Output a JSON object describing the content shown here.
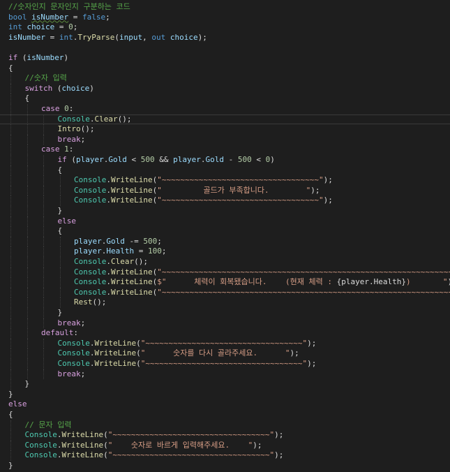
{
  "editor": {
    "background": "#1e1e1e",
    "colors": {
      "keyword": "#569cd6",
      "control": "#d8a0df",
      "variable": "#9cdcfe",
      "type": "#4ec9b0",
      "method": "#dcdcaa",
      "string": "#d69d85",
      "number": "#b5cea8",
      "comment": "#57a64a",
      "plain": "#dcdcdc"
    },
    "current_line": 11,
    "lines": [
      {
        "indent": 0,
        "tokens": [
          [
            "cmt",
            "//숫자인지 문자인지 구분하는 코드"
          ]
        ]
      },
      {
        "indent": 0,
        "tokens": [
          [
            "kw",
            "bool"
          ],
          [
            "pl",
            " "
          ],
          [
            "var",
            "isNumber",
            "squiggle"
          ],
          [
            "pl",
            " = "
          ],
          [
            "kw",
            "false"
          ],
          [
            "pl",
            ";"
          ]
        ]
      },
      {
        "indent": 0,
        "tokens": [
          [
            "kw",
            "int"
          ],
          [
            "pl",
            " "
          ],
          [
            "var",
            "choice"
          ],
          [
            "pl",
            " = "
          ],
          [
            "num",
            "0"
          ],
          [
            "pl",
            ";"
          ]
        ]
      },
      {
        "indent": 0,
        "tokens": [
          [
            "var",
            "isNumber"
          ],
          [
            "pl",
            " = "
          ],
          [
            "kw",
            "int"
          ],
          [
            "pl",
            "."
          ],
          [
            "fn",
            "TryParse"
          ],
          [
            "pl",
            "("
          ],
          [
            "var",
            "input"
          ],
          [
            "pl",
            ", "
          ],
          [
            "kw",
            "out"
          ],
          [
            "pl",
            " "
          ],
          [
            "var",
            "choice"
          ],
          [
            "pl",
            ");"
          ]
        ]
      },
      {
        "indent": 0,
        "tokens": []
      },
      {
        "indent": 0,
        "tokens": [
          [
            "ctl",
            "if"
          ],
          [
            "pl",
            " ("
          ],
          [
            "var",
            "isNumber"
          ],
          [
            "pl",
            ")"
          ]
        ]
      },
      {
        "indent": 0,
        "tokens": [
          [
            "pl",
            "{"
          ]
        ]
      },
      {
        "indent": 1,
        "tokens": [
          [
            "cmt",
            "//숫자 입력"
          ]
        ]
      },
      {
        "indent": 1,
        "tokens": [
          [
            "ctl",
            "switch"
          ],
          [
            "pl",
            " ("
          ],
          [
            "var",
            "choice"
          ],
          [
            "pl",
            ")"
          ]
        ]
      },
      {
        "indent": 1,
        "tokens": [
          [
            "pl",
            "{"
          ]
        ]
      },
      {
        "indent": 2,
        "tokens": [
          [
            "ctl",
            "case"
          ],
          [
            "pl",
            " "
          ],
          [
            "num",
            "0"
          ],
          [
            "pl",
            ":"
          ]
        ]
      },
      {
        "indent": 3,
        "tokens": [
          [
            "type",
            "Console"
          ],
          [
            "pl",
            "."
          ],
          [
            "fn",
            "Clear"
          ],
          [
            "pl",
            "();"
          ]
        ]
      },
      {
        "indent": 3,
        "tokens": [
          [
            "fn",
            "Intro"
          ],
          [
            "pl",
            "();"
          ]
        ]
      },
      {
        "indent": 3,
        "tokens": [
          [
            "ctl",
            "break"
          ],
          [
            "pl",
            ";"
          ]
        ]
      },
      {
        "indent": 2,
        "tokens": [
          [
            "ctl",
            "case"
          ],
          [
            "pl",
            " "
          ],
          [
            "num",
            "1"
          ],
          [
            "pl",
            ":"
          ]
        ]
      },
      {
        "indent": 3,
        "tokens": [
          [
            "ctl",
            "if"
          ],
          [
            "pl",
            " ("
          ],
          [
            "var",
            "player"
          ],
          [
            "pl",
            "."
          ],
          [
            "var",
            "Gold"
          ],
          [
            "pl",
            " < "
          ],
          [
            "num",
            "500"
          ],
          [
            "pl",
            " && "
          ],
          [
            "var",
            "player"
          ],
          [
            "pl",
            "."
          ],
          [
            "var",
            "Gold"
          ],
          [
            "pl",
            " - "
          ],
          [
            "num",
            "500"
          ],
          [
            "pl",
            " < "
          ],
          [
            "num",
            "0"
          ],
          [
            "pl",
            ")"
          ]
        ]
      },
      {
        "indent": 3,
        "tokens": [
          [
            "pl",
            "{"
          ]
        ]
      },
      {
        "indent": 4,
        "tokens": [
          [
            "type",
            "Console"
          ],
          [
            "pl",
            "."
          ],
          [
            "fn",
            "WriteLine"
          ],
          [
            "pl",
            "("
          ],
          [
            "str",
            "\"~~~~~~~~~~~~~~~~~~~~~~~~~~~~~~~~~~\""
          ],
          [
            "pl",
            ");"
          ]
        ]
      },
      {
        "indent": 4,
        "tokens": [
          [
            "type",
            "Console"
          ],
          [
            "pl",
            "."
          ],
          [
            "fn",
            "WriteLine"
          ],
          [
            "pl",
            "("
          ],
          [
            "str",
            "\"         골드가 부족합니다.        \""
          ],
          [
            "pl",
            ");"
          ]
        ]
      },
      {
        "indent": 4,
        "tokens": [
          [
            "type",
            "Console"
          ],
          [
            "pl",
            "."
          ],
          [
            "fn",
            "WriteLine"
          ],
          [
            "pl",
            "("
          ],
          [
            "str",
            "\"~~~~~~~~~~~~~~~~~~~~~~~~~~~~~~~~~~\""
          ],
          [
            "pl",
            ");"
          ]
        ]
      },
      {
        "indent": 3,
        "tokens": [
          [
            "pl",
            "}"
          ]
        ]
      },
      {
        "indent": 3,
        "tokens": [
          [
            "ctl",
            "else"
          ]
        ]
      },
      {
        "indent": 3,
        "tokens": [
          [
            "pl",
            "{"
          ]
        ]
      },
      {
        "indent": 4,
        "tokens": [
          [
            "var",
            "player"
          ],
          [
            "pl",
            "."
          ],
          [
            "var",
            "Gold"
          ],
          [
            "pl",
            " -= "
          ],
          [
            "num",
            "500"
          ],
          [
            "pl",
            ";"
          ]
        ]
      },
      {
        "indent": 4,
        "tokens": [
          [
            "var",
            "player"
          ],
          [
            "pl",
            "."
          ],
          [
            "var",
            "Health"
          ],
          [
            "pl",
            " = "
          ],
          [
            "num",
            "100"
          ],
          [
            "pl",
            ";"
          ]
        ]
      },
      {
        "indent": 4,
        "tokens": [
          [
            "type",
            "Console"
          ],
          [
            "pl",
            "."
          ],
          [
            "fn",
            "Clear"
          ],
          [
            "pl",
            "();"
          ]
        ]
      },
      {
        "indent": 4,
        "tokens": [
          [
            "type",
            "Console"
          ],
          [
            "pl",
            "."
          ],
          [
            "fn",
            "WriteLine"
          ],
          [
            "pl",
            "("
          ],
          [
            "str",
            "\"~~~~~~~~~~~~~~~~~~~~~~~~~~~~~~~~~~~~~~~~~~~~~~~~~~~~~~~~~~~~~~~~\""
          ],
          [
            "pl",
            ");"
          ]
        ]
      },
      {
        "indent": 4,
        "tokens": [
          [
            "type",
            "Console"
          ],
          [
            "pl",
            "."
          ],
          [
            "fn",
            "WriteLine"
          ],
          [
            "pl",
            "("
          ],
          [
            "str",
            "$\"      체력이 회복됐습니다.    (현재 체력 : "
          ],
          [
            "interp",
            "{player.Health}"
          ],
          [
            "str",
            ")       \""
          ],
          [
            "pl",
            ");"
          ]
        ]
      },
      {
        "indent": 4,
        "tokens": [
          [
            "type",
            "Console"
          ],
          [
            "pl",
            "."
          ],
          [
            "fn",
            "WriteLine"
          ],
          [
            "pl",
            "("
          ],
          [
            "str",
            "\"~~~~~~~~~~~~~~~~~~~~~~~~~~~~~~~~~~~~~~~~~~~~~~~~~~~~~~~~~~~~~~~~\""
          ],
          [
            "pl",
            ");"
          ]
        ]
      },
      {
        "indent": 4,
        "tokens": [
          [
            "fn",
            "Rest"
          ],
          [
            "pl",
            "();"
          ]
        ]
      },
      {
        "indent": 3,
        "tokens": [
          [
            "pl",
            "}"
          ]
        ]
      },
      {
        "indent": 3,
        "tokens": [
          [
            "ctl",
            "break"
          ],
          [
            "pl",
            ";"
          ]
        ]
      },
      {
        "indent": 2,
        "tokens": [
          [
            "ctl",
            "default"
          ],
          [
            "pl",
            ":"
          ]
        ]
      },
      {
        "indent": 3,
        "tokens": [
          [
            "type",
            "Console"
          ],
          [
            "pl",
            "."
          ],
          [
            "fn",
            "WriteLine"
          ],
          [
            "pl",
            "("
          ],
          [
            "str",
            "\"~~~~~~~~~~~~~~~~~~~~~~~~~~~~~~~~~~\""
          ],
          [
            "pl",
            ");"
          ]
        ]
      },
      {
        "indent": 3,
        "tokens": [
          [
            "type",
            "Console"
          ],
          [
            "pl",
            "."
          ],
          [
            "fn",
            "WriteLine"
          ],
          [
            "pl",
            "("
          ],
          [
            "str",
            "\"      숫자를 다시 골라주세요.      \""
          ],
          [
            "pl",
            ");"
          ]
        ]
      },
      {
        "indent": 3,
        "tokens": [
          [
            "type",
            "Console"
          ],
          [
            "pl",
            "."
          ],
          [
            "fn",
            "WriteLine"
          ],
          [
            "pl",
            "("
          ],
          [
            "str",
            "\"~~~~~~~~~~~~~~~~~~~~~~~~~~~~~~~~~~\""
          ],
          [
            "pl",
            ");"
          ]
        ]
      },
      {
        "indent": 3,
        "tokens": [
          [
            "ctl",
            "break"
          ],
          [
            "pl",
            ";"
          ]
        ]
      },
      {
        "indent": 1,
        "tokens": [
          [
            "pl",
            "}"
          ]
        ]
      },
      {
        "indent": 0,
        "tokens": [
          [
            "pl",
            "}"
          ]
        ]
      },
      {
        "indent": 0,
        "tokens": [
          [
            "ctl",
            "else"
          ]
        ]
      },
      {
        "indent": 0,
        "tokens": [
          [
            "pl",
            "{"
          ]
        ]
      },
      {
        "indent": 1,
        "tokens": [
          [
            "cmt",
            "// 문자 입력"
          ]
        ]
      },
      {
        "indent": 1,
        "tokens": [
          [
            "type",
            "Console"
          ],
          [
            "pl",
            "."
          ],
          [
            "fn",
            "WriteLine"
          ],
          [
            "pl",
            "("
          ],
          [
            "str",
            "\"~~~~~~~~~~~~~~~~~~~~~~~~~~~~~~~~~~\""
          ],
          [
            "pl",
            ");"
          ]
        ]
      },
      {
        "indent": 1,
        "tokens": [
          [
            "type",
            "Console"
          ],
          [
            "pl",
            "."
          ],
          [
            "fn",
            "WriteLine"
          ],
          [
            "pl",
            "("
          ],
          [
            "str",
            "\"    숫자로 바르게 입력해주세요.    \""
          ],
          [
            "pl",
            ");"
          ]
        ]
      },
      {
        "indent": 1,
        "tokens": [
          [
            "type",
            "Console"
          ],
          [
            "pl",
            "."
          ],
          [
            "fn",
            "WriteLine"
          ],
          [
            "pl",
            "("
          ],
          [
            "str",
            "\"~~~~~~~~~~~~~~~~~~~~~~~~~~~~~~~~~~\""
          ],
          [
            "pl",
            ");"
          ]
        ]
      },
      {
        "indent": 0,
        "tokens": [
          [
            "pl",
            "}"
          ]
        ]
      }
    ]
  }
}
